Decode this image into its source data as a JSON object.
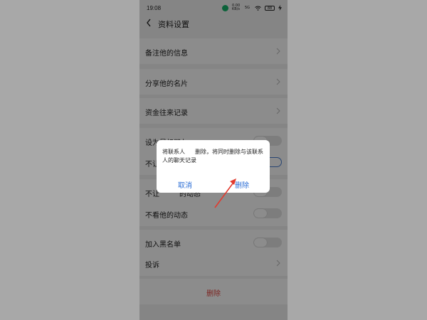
{
  "status_bar": {
    "time": "19:08",
    "net_speed": "0.00 KB/s",
    "signal": "5G",
    "battery": "88"
  },
  "header": {
    "title": "资料设置"
  },
  "settings": {
    "remark": "备注他的信息",
    "share_card": "分享他的名片",
    "money_records": "资金往来记录",
    "star_friend": "设为星标朋友",
    "hide_my_moments_partial": "不让",
    "hide_my_moments_2_partial": "不让",
    "hide_my_moments_2_tail": "的动态",
    "no_see_moments": "不看他的动态",
    "blacklist": "加入黑名单",
    "complaint": "投诉",
    "delete": "删除"
  },
  "dialog": {
    "message_prefix": "将联系人",
    "message_suffix": "删除，将同时删除与该联系人的聊天记录",
    "cancel": "取消",
    "confirm": "删除"
  },
  "colors": {
    "accent_blue": "#2d6fd6",
    "danger_red": "#e2443e",
    "annotation_red": "#e23a2e"
  }
}
